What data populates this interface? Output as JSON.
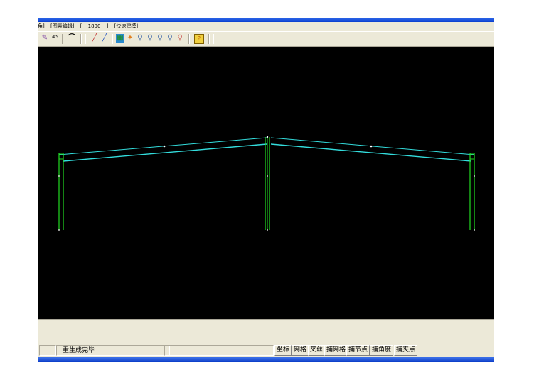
{
  "menu": {
    "items": [
      "角]",
      "[图素编辑]",
      "[",
      "1800",
      "]",
      "[快速建模]"
    ]
  },
  "status": {
    "message": "重生成完毕",
    "snap_buttons": [
      "坐标",
      "网格",
      "叉丝",
      "捕网格",
      "捕节点",
      "捕角度",
      "捕夹点"
    ]
  },
  "colors": {
    "canvas": "#000000",
    "column": "#22dd22",
    "rafter": "#33dddd",
    "node": "#ffffff"
  }
}
